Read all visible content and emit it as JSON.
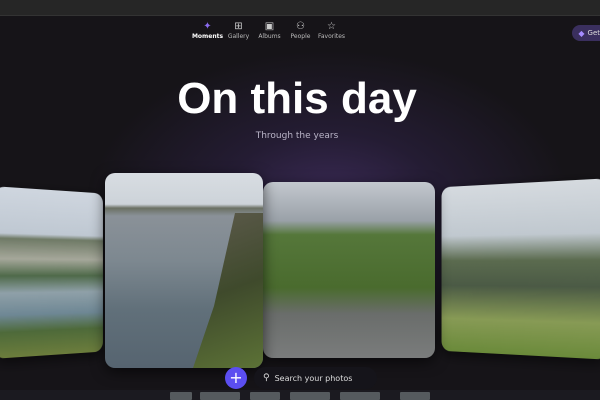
{
  "nav": {
    "items": [
      {
        "label": "Moments",
        "icon": "sparkle-icon",
        "active": true
      },
      {
        "label": "Gallery",
        "icon": "grid-icon"
      },
      {
        "label": "Albums",
        "icon": "album-icon"
      },
      {
        "label": "People",
        "icon": "people-icon"
      },
      {
        "label": "Favorites",
        "icon": "star-icon"
      }
    ]
  },
  "get_button": {
    "label": "Get",
    "icon": "diamond-icon"
  },
  "hero": {
    "title": "On this day",
    "subtitle": "Through the years"
  },
  "bottom": {
    "add_icon": "+",
    "search_placeholder": "Search your photos",
    "search_icon": "search-icon"
  },
  "colors": {
    "accent": "#5b4ef0"
  }
}
